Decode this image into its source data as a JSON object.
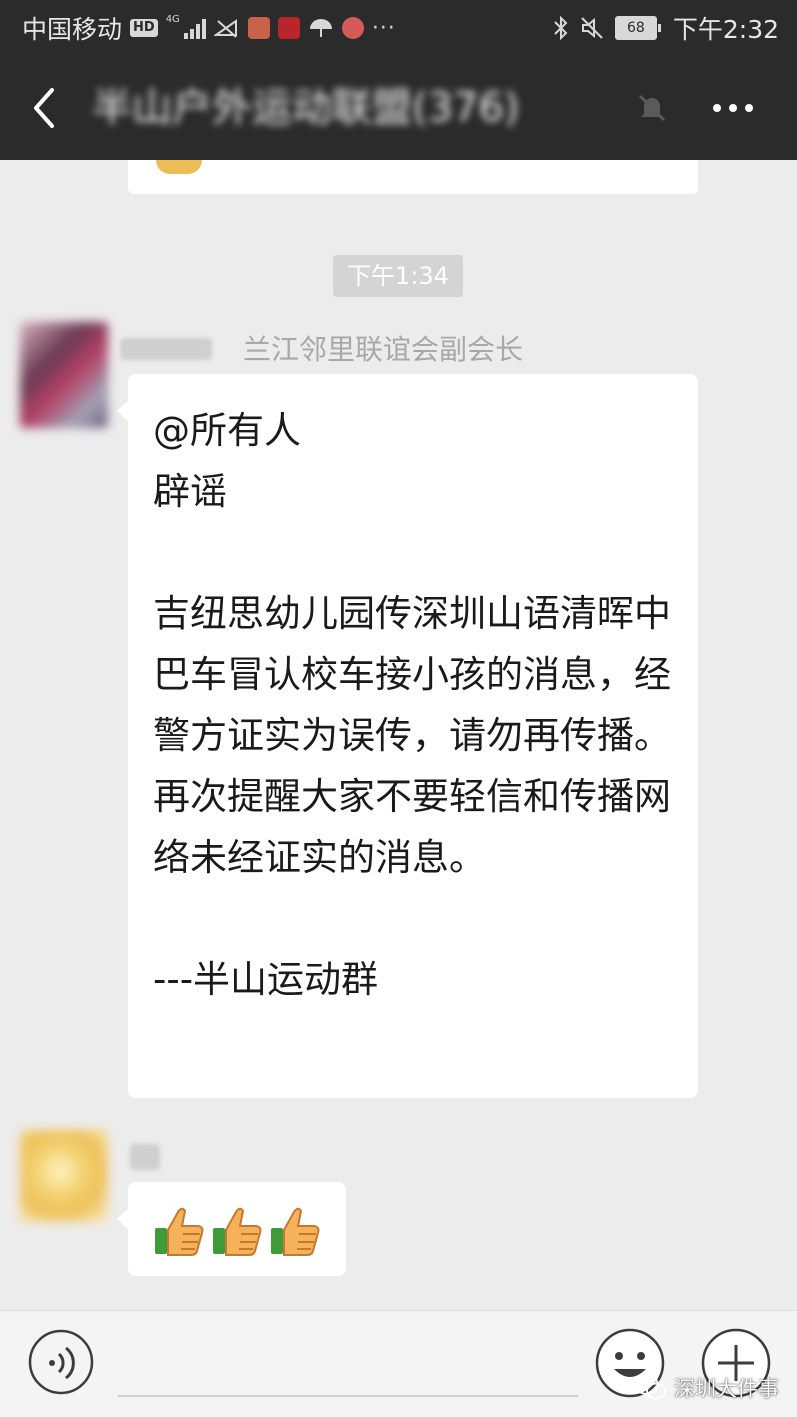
{
  "status_bar": {
    "carrier": "中国移动",
    "hd_badge": "HD",
    "network": "4G",
    "battery": "68",
    "time": "下午2:32",
    "more_indicator": "···"
  },
  "title_bar": {
    "chat_title": "半山户外运动联盟(376)",
    "icons": [
      "back-arrow-icon",
      "mute-bell-icon",
      "more-options-icon"
    ]
  },
  "chat": {
    "timestamp": "下午1:34",
    "messages": [
      {
        "sender_role": "兰江邻里联谊会副会长",
        "text": "@所有人\n辟谣\n\n吉纽思幼儿园传深圳山语清晖中巴车冒认校车接小孩的消息，经警方证实为误传，请勿再传播。\n再次提醒大家不要轻信和传播网络未经证实的消息。\n\n---半山运动群"
      },
      {
        "sender_role": "",
        "reactions": [
          "thumbs-up-icon",
          "thumbs-up-icon",
          "thumbs-up-icon"
        ]
      }
    ]
  },
  "input_bar": {
    "icons": [
      "voice-icon",
      "emoji-icon",
      "plus-icon"
    ]
  },
  "watermark": {
    "text": "深圳大件事"
  },
  "colors": {
    "header_bg": "#2b2b2c",
    "chat_bg": "#ececec",
    "bubble_bg": "#ffffff",
    "timestamp_bg": "#d4d4d4",
    "muted_text": "#a8a8a8"
  }
}
